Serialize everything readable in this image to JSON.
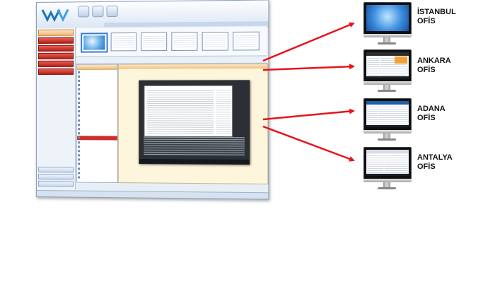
{
  "app": {
    "window_title": "",
    "sidebar": {
      "header": "",
      "items": [
        "",
        "",
        "",
        "",
        ""
      ],
      "bottom_items": [
        "",
        "",
        ""
      ]
    },
    "list_panel": {
      "header": "",
      "rows": [
        "",
        "",
        "",
        "",
        "",
        "",
        "",
        "",
        "",
        "",
        "",
        "",
        "",
        "",
        "",
        "",
        "",
        "",
        "",
        "",
        "",
        "",
        "",
        "",
        ""
      ]
    },
    "viewer": {
      "header": "",
      "footer": ""
    },
    "statusbar": ""
  },
  "offices": [
    {
      "line1": "İSTANBUL",
      "line2": "OFİS",
      "screen": "desktop"
    },
    {
      "line1": "ANKARA",
      "line2": "OFİS",
      "screen": "app"
    },
    {
      "line1": "ADANA",
      "line2": "OFİS",
      "screen": "app"
    },
    {
      "line1": "ANTALYA",
      "line2": "OFİS",
      "screen": "app"
    }
  ],
  "colors": {
    "arrow": "#e8141b",
    "sidebar_red": "#c9302c",
    "highlight_orange": "#f3c07f",
    "ribbon_blue": "#dbe6f4"
  },
  "icons": [
    "wv-logo-icon",
    "monitor-icon",
    "arrow-icon"
  ]
}
